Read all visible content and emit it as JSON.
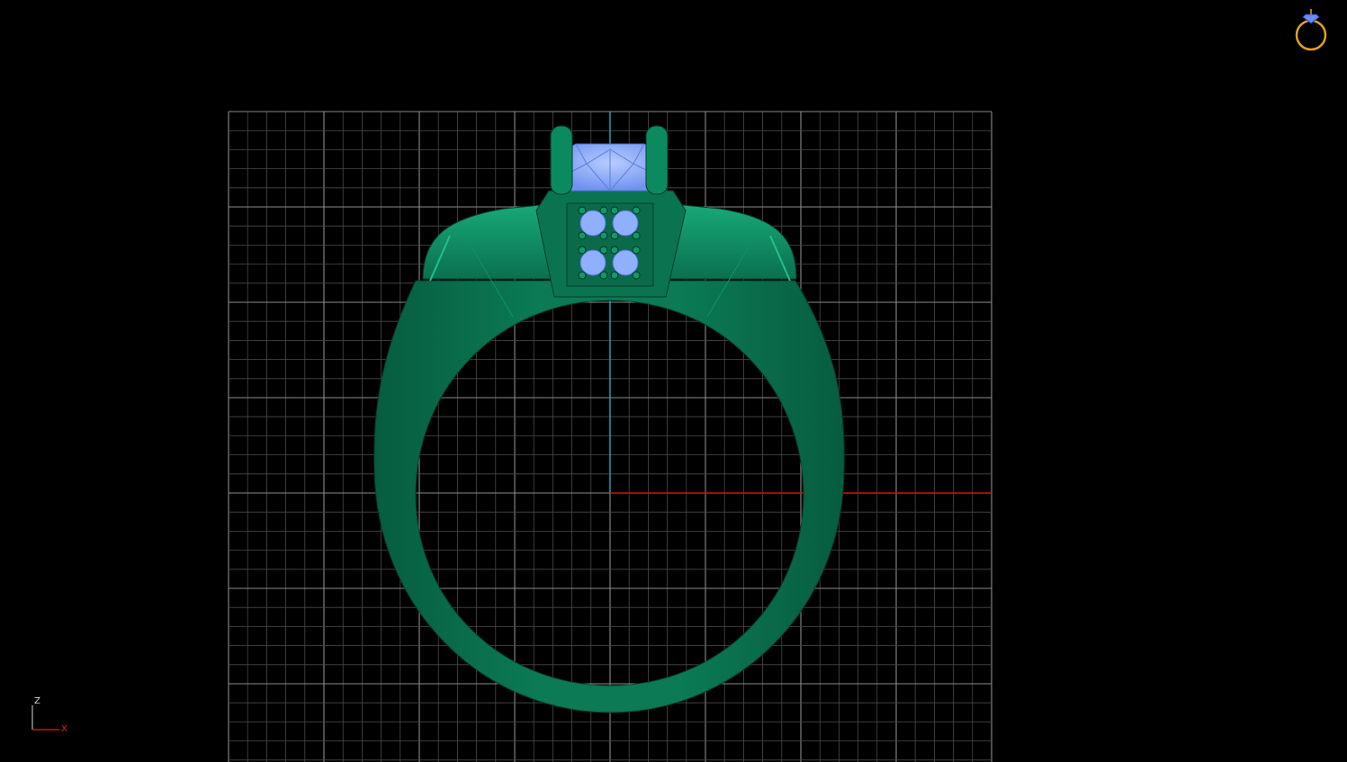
{
  "viewport": {
    "view_name": "front-view",
    "background": "#000000",
    "grid_color": "#6e6e6e",
    "axis_x_color": "#c81414",
    "axis_z_color": "#1fb0c8"
  },
  "model": {
    "metal_color": "#0b7a55",
    "stone_color": "#8fb0ff"
  },
  "axis_triad": {
    "vertical_label": "Z",
    "horizontal_label": "X",
    "z_color": "#d8d8d8",
    "x_color": "#e02020"
  },
  "corner_icon": {
    "name": "ring-icon",
    "color": "#e0a020",
    "gem_color": "#6a8cff"
  }
}
